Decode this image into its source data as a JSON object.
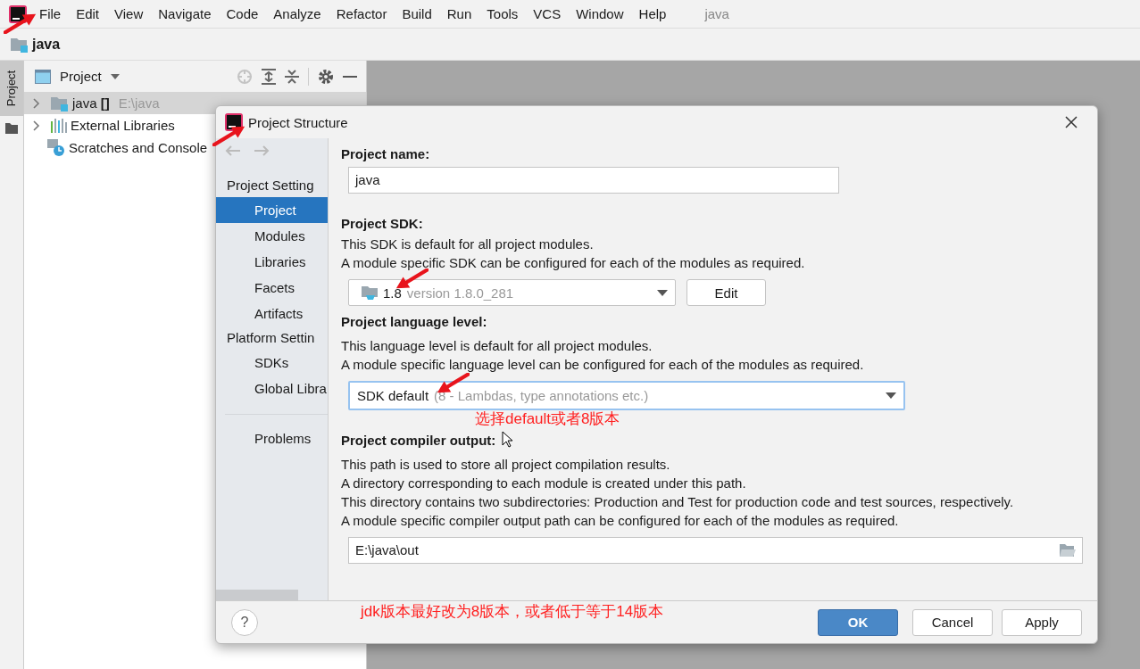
{
  "menu_bar": {
    "items": [
      "File",
      "Edit",
      "View",
      "Navigate",
      "Code",
      "Analyze",
      "Refactor",
      "Build",
      "Run",
      "Tools",
      "VCS",
      "Window",
      "Help"
    ],
    "project_title": "java"
  },
  "nav_bar": {
    "crumb": "java"
  },
  "tool_strip": {
    "label": "Project"
  },
  "project_panel": {
    "title": "Project",
    "tree": [
      {
        "label": "java **[]**",
        "path": "E:\\java",
        "expandable": true,
        "selected": true,
        "kind": "module"
      },
      {
        "label": "External Libraries",
        "expandable": true,
        "selected": false,
        "kind": "libraries"
      },
      {
        "label": "Scratches and Console",
        "expandable": false,
        "selected": false,
        "kind": "scratches"
      }
    ]
  },
  "dialog": {
    "title": "Project Structure",
    "sidebar": {
      "groups": [
        {
          "heading": "Project Setting",
          "items": [
            {
              "label": "Project",
              "selected": true
            },
            {
              "label": "Modules",
              "selected": false
            },
            {
              "label": "Libraries",
              "selected": false
            },
            {
              "label": "Facets",
              "selected": false
            },
            {
              "label": "Artifacts",
              "selected": false
            }
          ]
        },
        {
          "heading": "Platform Settin",
          "items": [
            {
              "label": "SDKs",
              "selected": false
            },
            {
              "label": "Global Libra",
              "selected": false
            }
          ]
        }
      ],
      "footer_items": [
        {
          "label": "Problems",
          "selected": false
        }
      ]
    },
    "project_name": {
      "label": "Project name:",
      "value": "java"
    },
    "sdk": {
      "label": "Project SDK:",
      "lines": [
        "This SDK is default for all project modules.",
        "A module specific SDK can be configured for each of the modules as required."
      ],
      "value": "1.8",
      "hint": "version 1.8.0_281",
      "edit_button": "Edit"
    },
    "language_level": {
      "label": "Project language level:",
      "lines": [
        "This language level is default for all project modules.",
        "A module specific language level can be configured for each of the modules as required."
      ],
      "value": "SDK default",
      "hint": "(8 - Lambdas, type annotations etc.)"
    },
    "compiler_output": {
      "label": "Project compiler output:",
      "lines": [
        "This path is used to store all project compilation results.",
        "A directory corresponding to each module is created under this path.",
        "This directory contains two subdirectories: Production and Test for production code and test sources, respectively.",
        "A module specific compiler output path can be configured for each of the modules as required."
      ],
      "value": "E:\\java\\out"
    },
    "buttons": [
      {
        "label": "OK",
        "kind": "default"
      },
      {
        "label": "Cancel",
        "kind": "normal"
      },
      {
        "label": "Apply",
        "kind": "normal"
      }
    ],
    "help": "?"
  },
  "annotations": [
    "选择default或者8版本",
    "jdk版本最好改为8版本，或者低于等于14版本"
  ]
}
